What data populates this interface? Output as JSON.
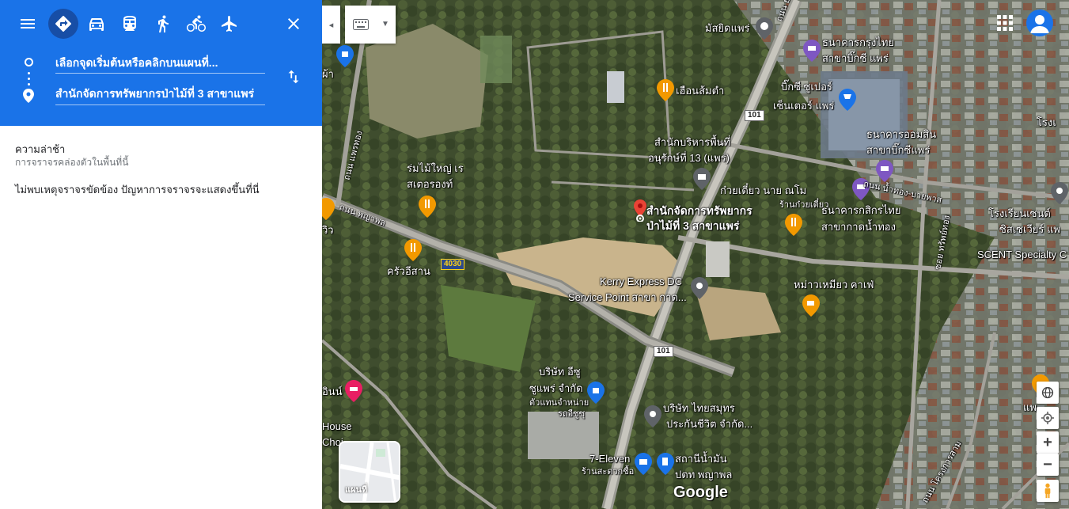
{
  "sidebar": {
    "origin_placeholder": "เลือกจุดเริ่มต้นหรือคลิกบนแผนที่...",
    "destination_value": "สำนักจัดการทรัพยากรป่าไม้ที่ 3 สาขาแพร่",
    "modes": [
      "best",
      "driving",
      "transit",
      "walking",
      "cycling",
      "flights"
    ],
    "active_mode": "best",
    "traffic_title": "ความล่าช้า",
    "traffic_subtitle": "การจราจรคล่องตัวในพื้นที่นี้",
    "traffic_message": "ไม่พบเหตุจราจรขัดข้อง ปัญหาการจราจรจะแสดงขึ้นที่นี่"
  },
  "map": {
    "layer_label": "แผนที่",
    "logo": "Google",
    "colors": {
      "accent": "#1a73e8",
      "accent_dark": "#174ea6",
      "pin_red": "#ea4335",
      "food": "#f29900",
      "shop": "#1a73e8",
      "gray_poi": "#5f6368",
      "hotel": "#e91e63"
    },
    "labels": {
      "mosque": "มัสยิดแพร่",
      "bangkok_bank_1": "ธนาคารกรุงไทย",
      "bangkok_bank_2": "สาขาบิ๊กซี แพร่",
      "restaurant": "เฮือนส้มตำ",
      "bigc_1": "บิ๊กซี ซูเปอร์",
      "bigc_2": "เซ็นเตอร์ แพร่",
      "gsb_1": "ธนาคารออมสิน",
      "gsb_2": "สาขาบิ๊กซีแพร่",
      "park_office_1": "สำนักบริหารพื้นที่",
      "park_office_2": "อนุรักษ์ที่ 13 (แพร่)",
      "rom_mai_1": "ร่มไม้ใหญ่ เร",
      "rom_mai_2": "สเตอรองท์",
      "noodle": "ก๋วยเตี๋ยว นาย ณโม",
      "noodle_sub": "ร้านก๋วยเตี๋ยว",
      "dest_1": "สำนักจัดการทรัพยากร",
      "dest_2": "ป่าไม้ที่ 3 สาขาแพร่",
      "kasikorn_1": "ธนาคารกสิกรไทย",
      "kasikorn_2": "สาขากาดน้ำทอง",
      "road_namthong": "ถนน น้ำทอง-บายพาส",
      "school_1": "โรงเรียนเซนต์",
      "school_2": "ซิสเซเวียร์ แพ",
      "scent": "SCENT Specialty C",
      "road_phayapol": "ถนน พญาพล",
      "road_phrathong": "ถนน แพรทอง",
      "view": "วิว",
      "khrua_isan": "ครัวอีสาน",
      "kerry_1": "Kerry Express DC",
      "kerry_2": "Service Point สาขา กาด...",
      "cafe": "หม่าวเหมียว คาเฟ่",
      "isuzu_1": "บริษัท อีซู",
      "isuzu_2": "ซูแพร่ จำกัด",
      "isuzu_3": "ตัวแทนจำหน่าย",
      "isuzu_4": "รถอีซูซุ",
      "thai_samut_1": "บริษัท ไทยสมุทร",
      "thai_samut_2": "ประกันชีวิต จำกัด...",
      "seven_1": "7-Eleven",
      "seven_2": "ร้านสะดวกซื้อ",
      "ptt_1": "สถานีน้ำมัน",
      "ptt_2": "ปตท พญาพล",
      "inn": "อินน์",
      "house": "House",
      "cho": "Choi",
      "phrae_small": "แพ",
      "rong": "โรงเ",
      "pha": "ผ้า",
      "road_top": "ถนน ย",
      "road_right": "ซอย ทรัพย์ทอง",
      "road_bottom": "ถนน โครงการสาม"
    },
    "shields": {
      "r101_top": "101",
      "r101_bottom": "101",
      "r4030": "4030"
    }
  }
}
